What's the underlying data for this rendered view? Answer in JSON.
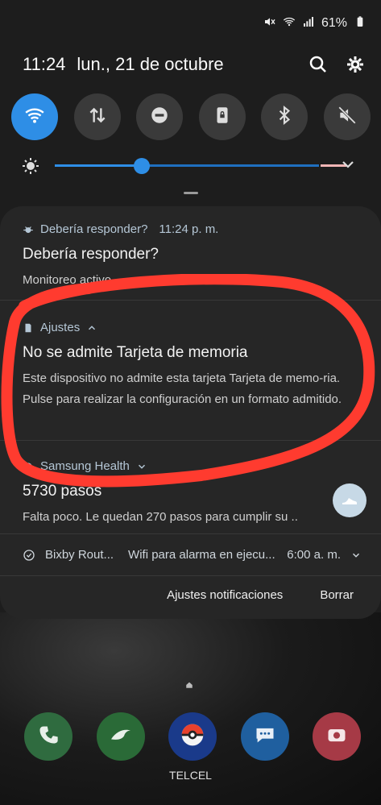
{
  "status_bar": {
    "battery": "61%"
  },
  "header": {
    "time": "11:24",
    "date": "lun., 21 de octubre"
  },
  "notifications": [
    {
      "app": "Debería responder?",
      "time": "11:24 p. m.",
      "title": "Debería responder?",
      "body": "Monitoreo activo"
    },
    {
      "app": "Ajustes",
      "title": "No se admite Tarjeta de memoria",
      "body": "Este dispositivo no admite esta tarjeta Tarjeta de memo-ria. Pulse para realizar la configuración en un formato admitido."
    },
    {
      "app": "Samsung Health",
      "title": "5730 pasos",
      "body": "Falta poco. Le quedan 270 pasos para cumplir su .."
    }
  ],
  "bixby": {
    "app": "Bixby Rout...",
    "text": "Wifi para alarma  en ejecu...",
    "time": "6:00 a. m."
  },
  "actions": {
    "settings": "Ajustes notificaciones",
    "clear": "Borrar"
  },
  "brightness_level": 0.33,
  "carrier": "TELCEL",
  "colors": {
    "accent": "#2e8ee6",
    "highlight_loop": "#ff3b2f"
  }
}
